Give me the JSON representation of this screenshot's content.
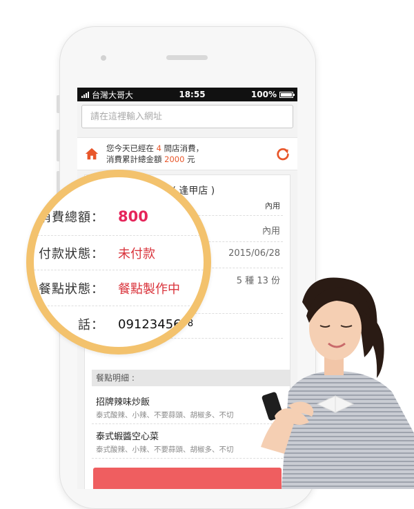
{
  "status_bar": {
    "carrier": "台灣大哥大",
    "time": "18:55",
    "battery": "100%"
  },
  "url_bar": {
    "placeholder": "請在這裡輸入網址"
  },
  "notice": {
    "text_1": "您今天已經在 ",
    "store_count": "4",
    "text_2": " 間店消費，",
    "text_3": "消費累計總金額 ",
    "total_amount": "2000",
    "text_4": " 元"
  },
  "order": {
    "store_name": "好餐廳 ( 逢甲店 )",
    "dine_type_header": "內用",
    "dine_type": "內用",
    "date": "2015/06/28",
    "items_summary": "5 種 13 份",
    "phone_tail": "5678",
    "detail_header": "餐點明細 :",
    "items": [
      {
        "name": "招牌辣味炒飯",
        "options": "泰式酸辣、小辣、不要蒜頭、胡椒多、不切"
      },
      {
        "name": "泰式蝦醬空心菜",
        "options": "泰式酸辣、小辣、不要蒜頭、胡椒多、不切"
      }
    ]
  },
  "magnifier": {
    "total_label": "消費總額：",
    "total_value": "800",
    "payment_label": "付款狀態：",
    "payment_value": "未付款",
    "meal_label": "餐點狀態：",
    "meal_value": "餐點製作中",
    "phone_label": "電　　話：",
    "phone_value": "0912345678"
  },
  "colors": {
    "accent": "#e8562a",
    "amount_pink": "#e5255a",
    "status_red": "#d9333b",
    "ring": "#f3c26d",
    "button": "#ef5e60"
  },
  "icons": {
    "home": "home-icon",
    "refresh": "refresh-icon"
  }
}
